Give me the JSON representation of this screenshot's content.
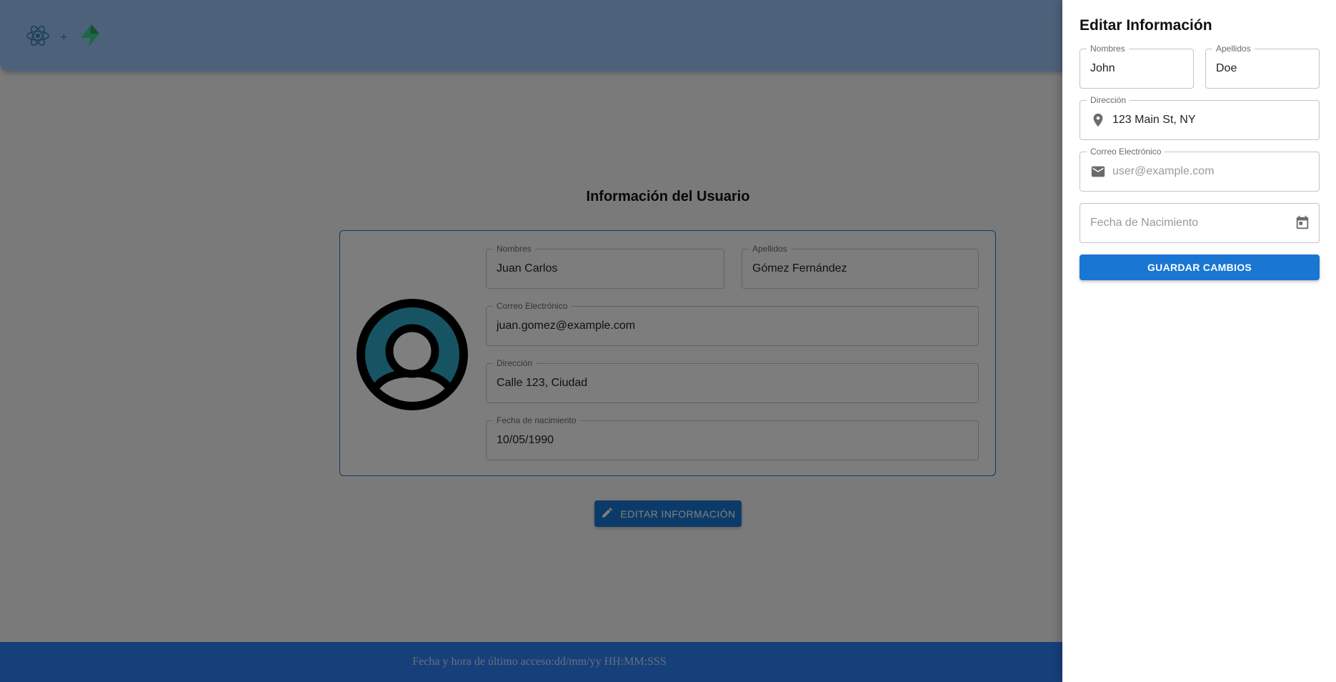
{
  "header": {
    "logos": [
      "react-logo-icon",
      "plus-separator",
      "supabase-logo-icon"
    ],
    "plus": "+"
  },
  "main": {
    "title": "Información del Usuario",
    "avatar_icon": "account-circle-icon",
    "fields": {
      "nombres": {
        "label": "Nombres",
        "value": "Juan Carlos"
      },
      "apellidos": {
        "label": "Apellidos",
        "value": "Gómez Fernández"
      },
      "correo": {
        "label": "Correo Electrónico",
        "value": "juan.gomez@example.com"
      },
      "direccion": {
        "label": "Dirección",
        "value": "Calle 123, Ciudad"
      },
      "fecha": {
        "label": "Fecha de nacimiento",
        "value": "10/05/1990"
      }
    },
    "edit_button": {
      "label": "EDITAR INFORMACIÓN",
      "icon": "pencil-icon"
    }
  },
  "footer": {
    "text": "Fecha y hora de último acceso:dd/mm/yy HH:MM:SSS"
  },
  "drawer": {
    "title": "Editar Información",
    "fields": {
      "nombres": {
        "label": "Nombres",
        "value": "John"
      },
      "apellidos": {
        "label": "Apellidos",
        "value": "Doe"
      },
      "direccion": {
        "label": "Dirección",
        "value": "123 Main St, NY",
        "icon": "location-pin-icon"
      },
      "correo": {
        "label": "Correo Electrónico",
        "placeholder": "user@example.com",
        "icon": "mail-icon"
      },
      "fecha": {
        "placeholder": "Fecha de Nacimiento",
        "icon": "calendar-icon"
      }
    },
    "save_button": {
      "label": "GUARDAR CAMBIOS"
    }
  },
  "colors": {
    "header": "#9bc4f4",
    "primary": "#1976d2",
    "footer": "#2f81f7",
    "avatar_fill": "#2fa8c6",
    "backdrop": "rgba(0,0,0,0.5)"
  }
}
